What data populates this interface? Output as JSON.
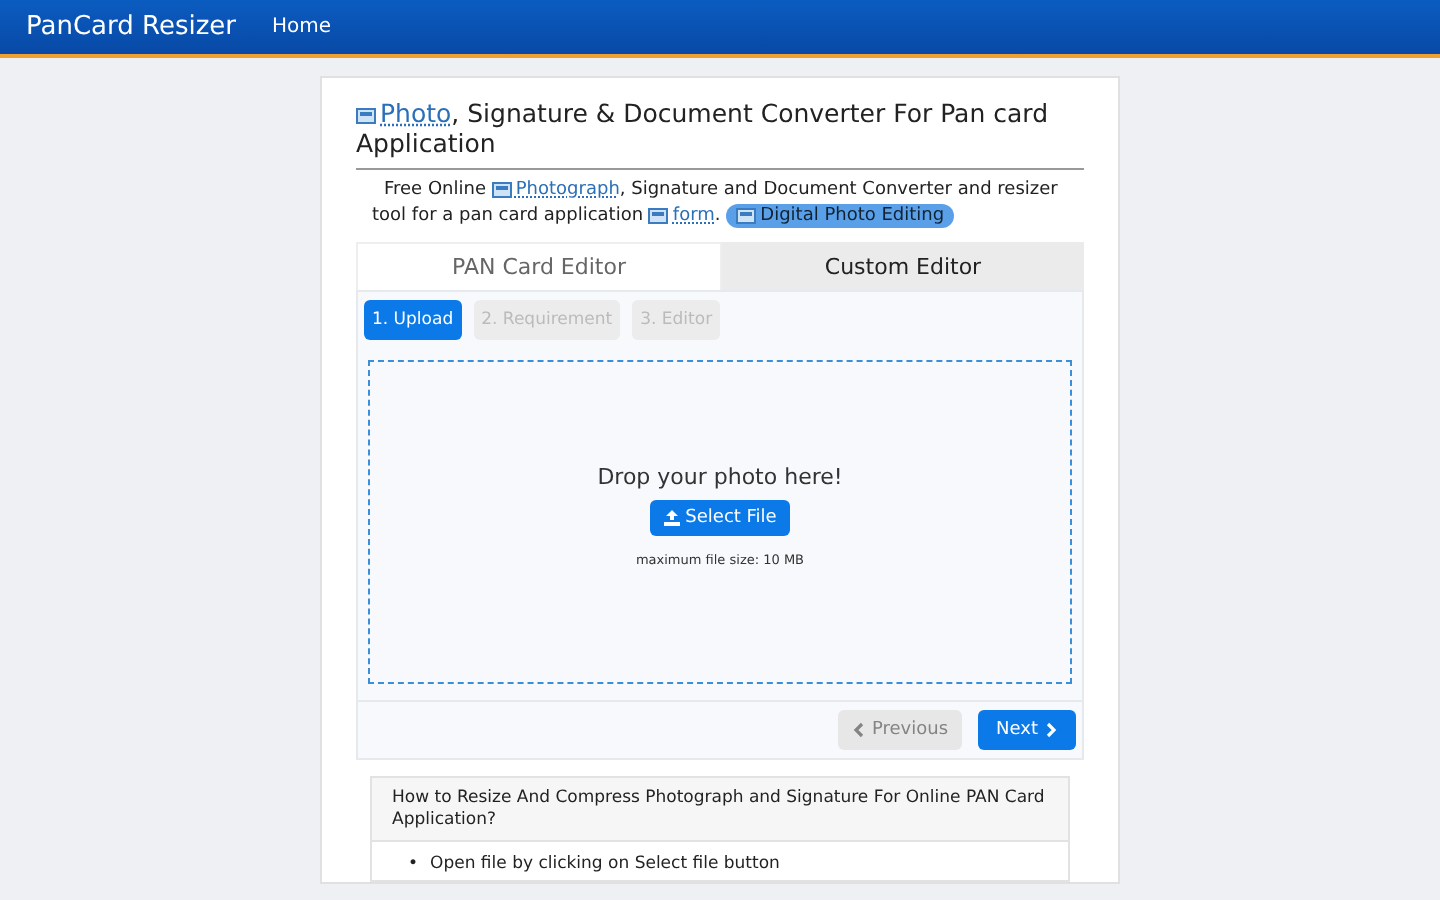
{
  "navbar": {
    "brand": "PanCard Resizer",
    "links": [
      {
        "label": "Home"
      }
    ]
  },
  "heading": {
    "link": "Photo",
    "rest": ", Signature & Document Converter For Pan card Application"
  },
  "intro": {
    "before": "Free Online",
    "link1": "Photograph",
    "middle": ", Signature and Document Converter and resizer tool for a pan card application",
    "link2": "form",
    "after": ".",
    "badge": "Digital Photo Editing"
  },
  "tabs": [
    {
      "label": "PAN Card Editor",
      "selected": true
    },
    {
      "label": "Custom Editor",
      "selected": false
    }
  ],
  "steps": [
    {
      "label": "1. Upload",
      "selected": true
    },
    {
      "label": "2. Requirement",
      "selected": false
    },
    {
      "label": "3. Editor",
      "selected": false
    }
  ],
  "dropzone": {
    "prompt": "Drop your photo here!",
    "button": "Select File",
    "note": "maximum file size: 10 MB"
  },
  "footer_buttons": [
    {
      "label": "Previous",
      "kind": "prev",
      "disabled": true
    },
    {
      "label": "Next",
      "kind": "next",
      "disabled": false
    }
  ],
  "howto": {
    "title": "How to Resize And Compress Photograph and Signature For Online PAN Card Application?",
    "items": [
      {
        "marker": "•",
        "text": "Open file by clicking on Select file button"
      }
    ]
  }
}
